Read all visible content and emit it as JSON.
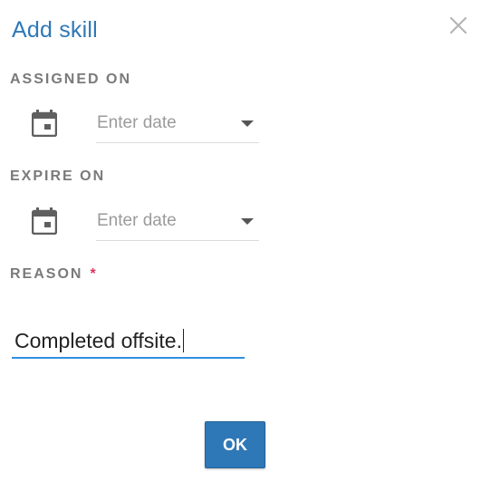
{
  "dialog": {
    "title": "Add skill",
    "close_icon": "close-icon"
  },
  "assigned_on": {
    "label": "ASSIGNED ON",
    "icon": "calendar-icon",
    "placeholder": "Enter date",
    "dropdown_icon": "chevron-down-icon"
  },
  "expire_on": {
    "label": "EXPIRE ON",
    "icon": "calendar-icon",
    "placeholder": "Enter date",
    "dropdown_icon": "chevron-down-icon"
  },
  "reason": {
    "label": "REASON",
    "required_marker": "*",
    "value": "Completed offsite."
  },
  "actions": {
    "ok_label": "OK"
  },
  "colors": {
    "accent": "#2f78b7",
    "focus_underline": "#2f8fe0",
    "required": "#d9365f",
    "label_gray": "#7a7a7a"
  }
}
